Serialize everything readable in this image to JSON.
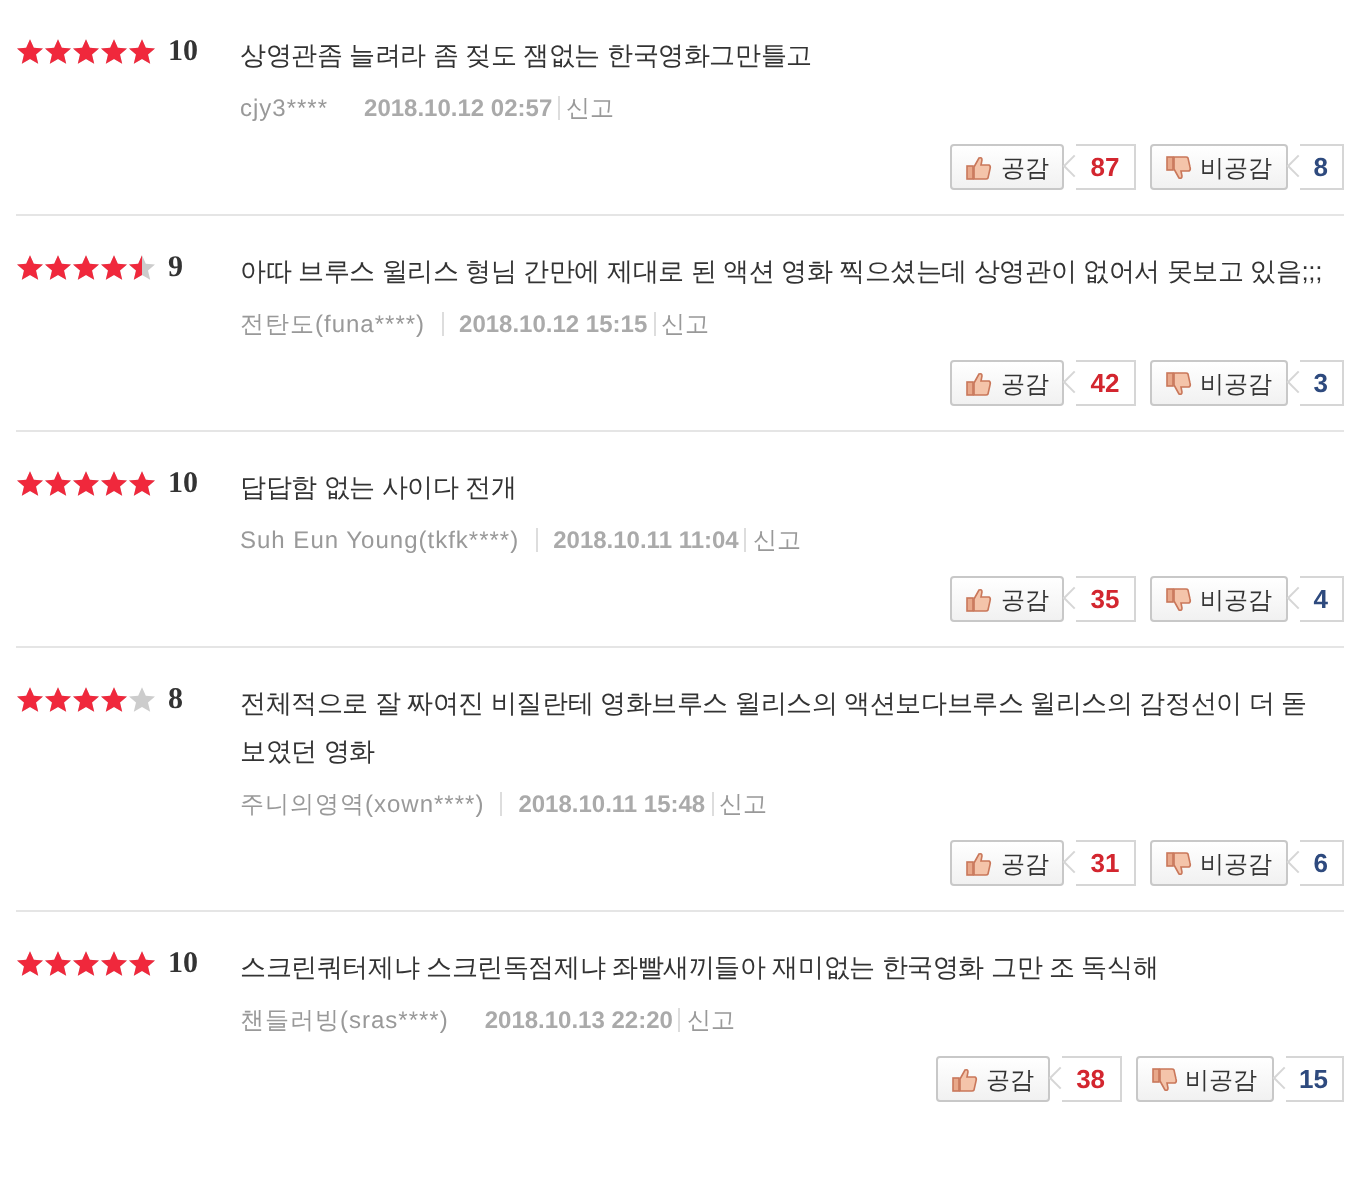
{
  "reviews": [
    {
      "stars": 5,
      "score": "10",
      "text": "상영관좀 늘려라 좀 젖도 잼없는 한국영화그만틀고",
      "author": "cjy3****",
      "author_divider": false,
      "date": "2018.10.12 02:57",
      "report": "신고",
      "like_label": "공감",
      "likes": "87",
      "dislike_label": "비공감",
      "dislikes": "8"
    },
    {
      "stars": 4.5,
      "score": "9",
      "text": "아따 브루스 윌리스 형님 간만에 제대로 된 액션 영화 찍으셨는데 상영관이 없어서 못보고 있음;;;",
      "author": "전탄도(funa****)",
      "author_divider": true,
      "date": "2018.10.12 15:15",
      "report": "신고",
      "like_label": "공감",
      "likes": "42",
      "dislike_label": "비공감",
      "dislikes": "3"
    },
    {
      "stars": 5,
      "score": "10",
      "text": "답답함 없는 사이다 전개",
      "author": "Suh Eun Young(tkfk****)",
      "author_divider": true,
      "date": "2018.10.11 11:04",
      "report": "신고",
      "like_label": "공감",
      "likes": "35",
      "dislike_label": "비공감",
      "dislikes": "4"
    },
    {
      "stars": 4,
      "score": "8",
      "text": "전체적으로 잘 짜여진 비질란테 영화브루스 윌리스의 액션보다브루스 윌리스의 감정선이 더 돋보였던 영화",
      "author": "주니의영역(xown****)",
      "author_divider": true,
      "date": "2018.10.11 15:48",
      "report": "신고",
      "like_label": "공감",
      "likes": "31",
      "dislike_label": "비공감",
      "dislikes": "6"
    },
    {
      "stars": 5,
      "score": "10",
      "text": "스크린쿼터제냐 스크린독점제냐 좌빨새끼들아 재미없는 한국영화 그만 조 독식해",
      "author": "챈들러빙(sras****)",
      "author_divider": false,
      "date": "2018.10.13 22:20",
      "report": "신고",
      "like_label": "공감",
      "likes": "38",
      "dislike_label": "비공감",
      "dislikes": "15"
    }
  ]
}
